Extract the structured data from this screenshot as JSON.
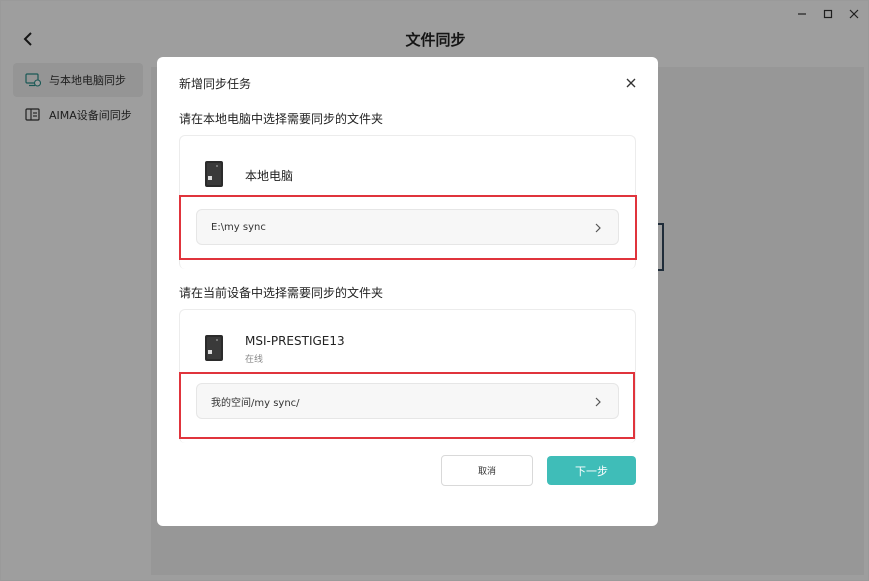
{
  "window": {
    "title": "文件同步",
    "controls": [
      "minimize",
      "maximize",
      "close"
    ]
  },
  "sidebar": {
    "items": [
      {
        "label": "与本地电脑同步",
        "icon": "sync-computer-icon",
        "active": true
      },
      {
        "label": "AIMA设备间同步",
        "icon": "device-sync-icon",
        "active": false
      }
    ]
  },
  "modal": {
    "title": "新增同步任务",
    "local_section": {
      "label": "请在本地电脑中选择需要同步的文件夹",
      "device_name": "本地电脑",
      "path": "E:\\my sync"
    },
    "device_section": {
      "label": "请在当前设备中选择需要同步的文件夹",
      "device_name": "MSI-PRESTIGE13",
      "status": "在线",
      "path": "我的空间/my sync/"
    },
    "cancel_label": "取消",
    "next_label": "下一步"
  },
  "colors": {
    "accent": "#3fbdb8",
    "highlight": "#e0343c",
    "overlay": "rgba(0,0,0,0.38)"
  }
}
